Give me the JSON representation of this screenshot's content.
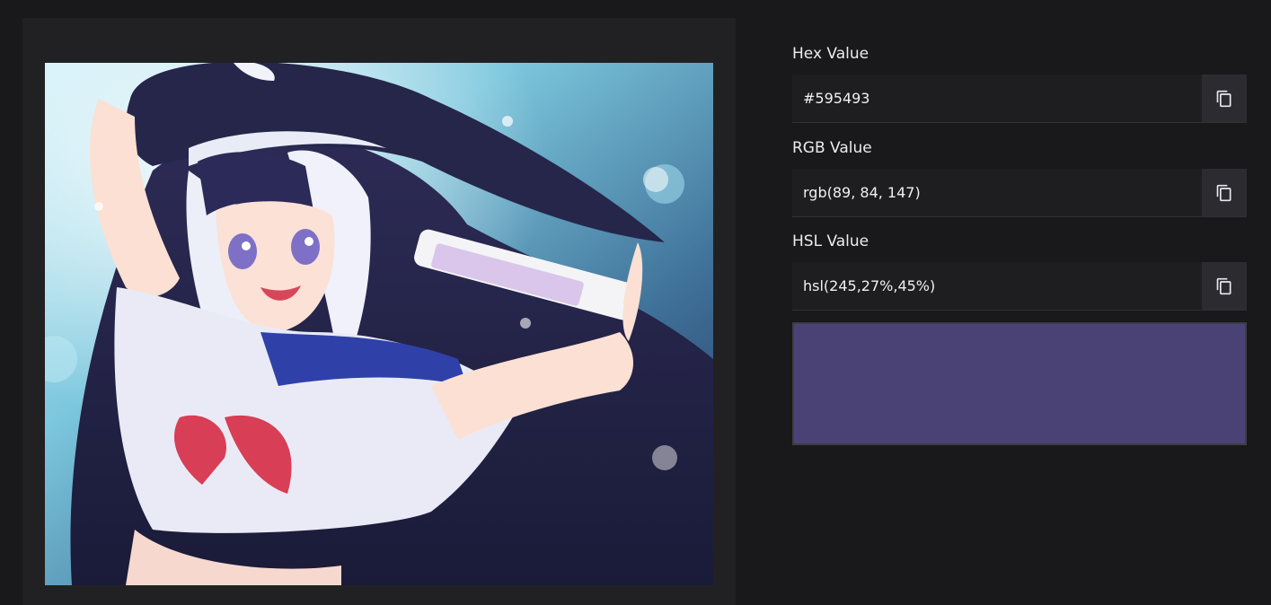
{
  "picker": {
    "image_alt": "Anime character illustration",
    "swatch_color": "#4a4275"
  },
  "fields": {
    "hex": {
      "label": "Hex Value",
      "value": "#595493"
    },
    "rgb": {
      "label": "RGB Value",
      "value": "rgb(89, 84, 147)"
    },
    "hsl": {
      "label": "HSL Value",
      "value": "hsl(245,27%,45%)"
    }
  },
  "icons": {
    "copy": "copy-icon"
  },
  "colors": {
    "background": "#19191b",
    "panel": "#212124",
    "input": "#1e1e21",
    "copy_button": "#2b2b30"
  }
}
